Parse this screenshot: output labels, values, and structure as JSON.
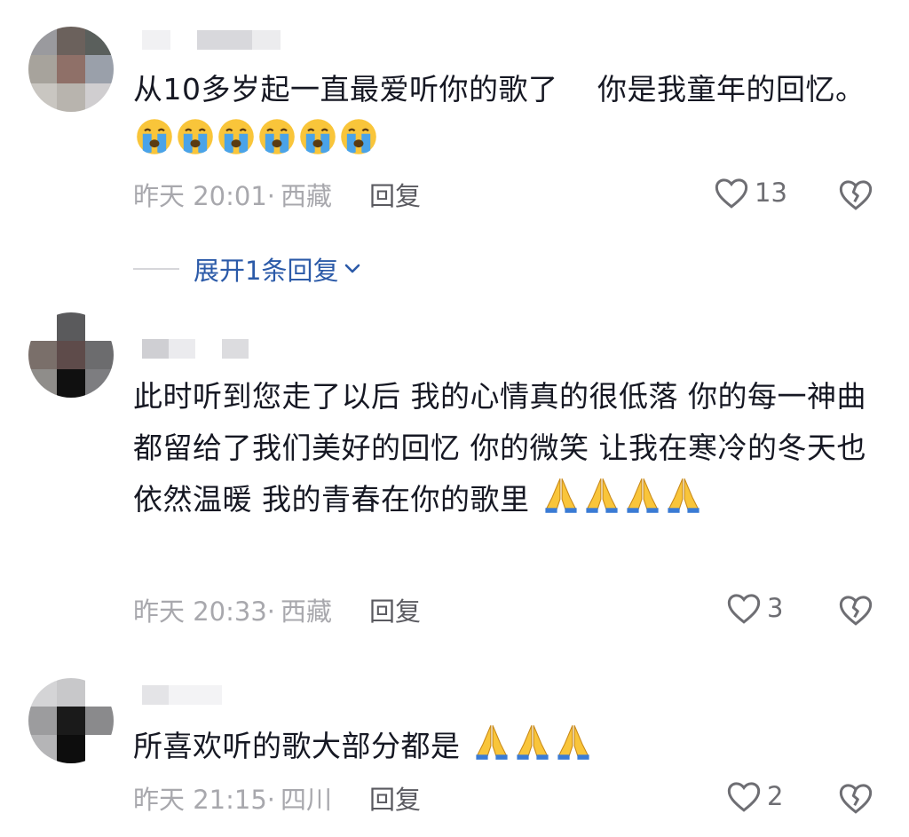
{
  "comments": [
    {
      "text": "从10多岁起一直最爱听你的歌了　 你是我童年的回忆。",
      "time": "昨天 20:01·",
      "location": "西藏",
      "reply_label": "回复",
      "likes": "13",
      "emoji": [
        "loudly-crying-face",
        "loudly-crying-face",
        "loudly-crying-face",
        "loudly-crying-face",
        "loudly-crying-face",
        "loudly-crying-face"
      ]
    },
    {
      "text": "此时听到您走了以后 我的心情真的很低落 你的每一神曲 都留给了我们美好的回忆 你的微笑 让我在寒冷的冬天也依然温暖 我的青春在你的歌里",
      "time": "昨天 20:33·",
      "location": "西藏",
      "reply_label": "回复",
      "likes": "3",
      "emoji": [
        "folded-hands",
        "folded-hands",
        "folded-hands",
        "folded-hands"
      ]
    },
    {
      "text": "所喜欢听的歌大部分都是",
      "time": "昨天 21:15·",
      "location": "四川",
      "reply_label": "回复",
      "likes": "2",
      "emoji": [
        "folded-hands",
        "folded-hands",
        "folded-hands"
      ]
    }
  ],
  "expand_replies": {
    "label": "展开1条回复"
  },
  "colors": {
    "text": "#161823",
    "meta": "#a8a8ad",
    "link": "#2b5aa8",
    "emoji_yellow": "#f9c53a",
    "emoji_tear": "#4aa3e8"
  }
}
